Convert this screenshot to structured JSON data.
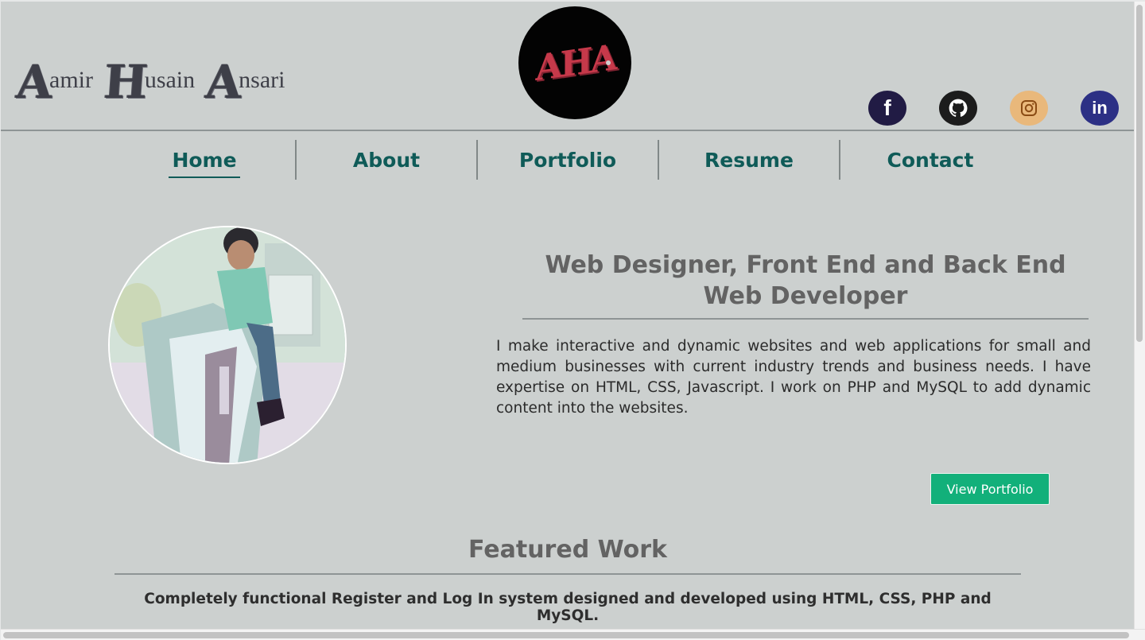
{
  "header": {
    "brand": [
      {
        "cap": "A",
        "rest": "amir"
      },
      {
        "cap": "H",
        "rest": "usain"
      },
      {
        "cap": "A",
        "rest": "nsari"
      }
    ],
    "logo_text": "AHA",
    "social": [
      {
        "name": "facebook",
        "glyph": "f",
        "color": "#211b44"
      },
      {
        "name": "github",
        "glyph": "",
        "color": "#1c1c1c"
      },
      {
        "name": "instagram",
        "glyph": "",
        "color": "#e9b87b"
      },
      {
        "name": "linkedin",
        "glyph": "in",
        "color": "#2c3085"
      }
    ]
  },
  "nav": {
    "items": [
      "Home",
      "About",
      "Portfolio",
      "Resume",
      "Contact"
    ],
    "active": "Home"
  },
  "hero": {
    "title": "Web Designer, Front End and Back End Web Developer",
    "text": "I make interactive and dynamic websites and web applications for small and medium businesses with current industry trends and business needs. I have expertise on HTML, CSS, Javascript. I work on PHP and MySQL to add dynamic content into the websites.",
    "button": "View Portfolio"
  },
  "featured": {
    "title": "Featured Work",
    "text": "Completely functional Register and Log In system designed and developed using HTML, CSS, PHP and MySQL."
  },
  "colors": {
    "background": "#ccd0cf",
    "nav_text": "#0f5b58",
    "heading": "#636363",
    "button": "#12b07a"
  }
}
